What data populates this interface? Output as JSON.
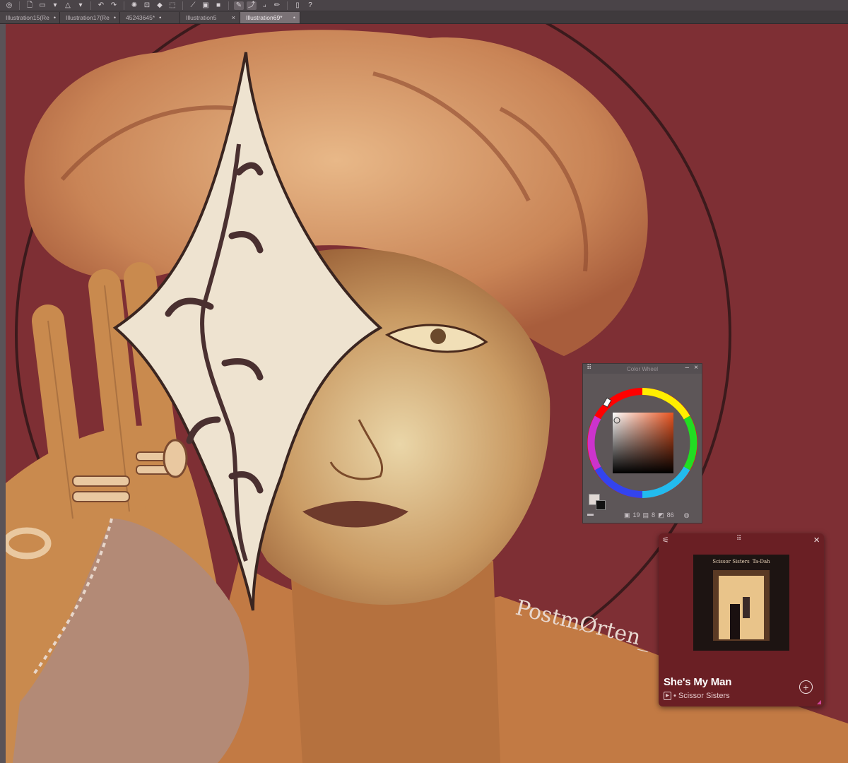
{
  "app": {
    "accent": "#7a7276",
    "canvas_bg": "#7d2e33"
  },
  "toolbar": {
    "icons": [
      "app-logo-icon",
      "new-file-icon",
      "open-folder-icon",
      "dropdown-icon",
      "triangle-warning-icon",
      "undo-icon",
      "redo-icon",
      "loading-icon",
      "transform-icon",
      "fill-icon",
      "select-icon",
      "pen-icon",
      "stroke-icon",
      "ruler-icon",
      "frame-icon",
      "pencil-icon",
      "phone-icon",
      "help-icon"
    ]
  },
  "tabs": [
    {
      "label": "Illustration15(Re",
      "active": false
    },
    {
      "label": "Illustration17(Re",
      "active": false
    },
    {
      "label": "45243645*",
      "active": false
    },
    {
      "label": "Illustration5",
      "active": false
    },
    {
      "label": "Illustration69*",
      "active": true
    }
  ],
  "signature": "PostmØrten_",
  "color_wheel": {
    "title": "Color Wheel",
    "value_a": "19",
    "value_b": "8",
    "value_c": "86",
    "main_color": "#e0d8d4",
    "sub_color": "#111111"
  },
  "music_player": {
    "song_title": "She's My Man",
    "artist": "Scissor Sisters",
    "album_header_left": "Scissor Sisters",
    "album_header_right": "Ta-Dah",
    "bg_color": "#6a1f24"
  }
}
